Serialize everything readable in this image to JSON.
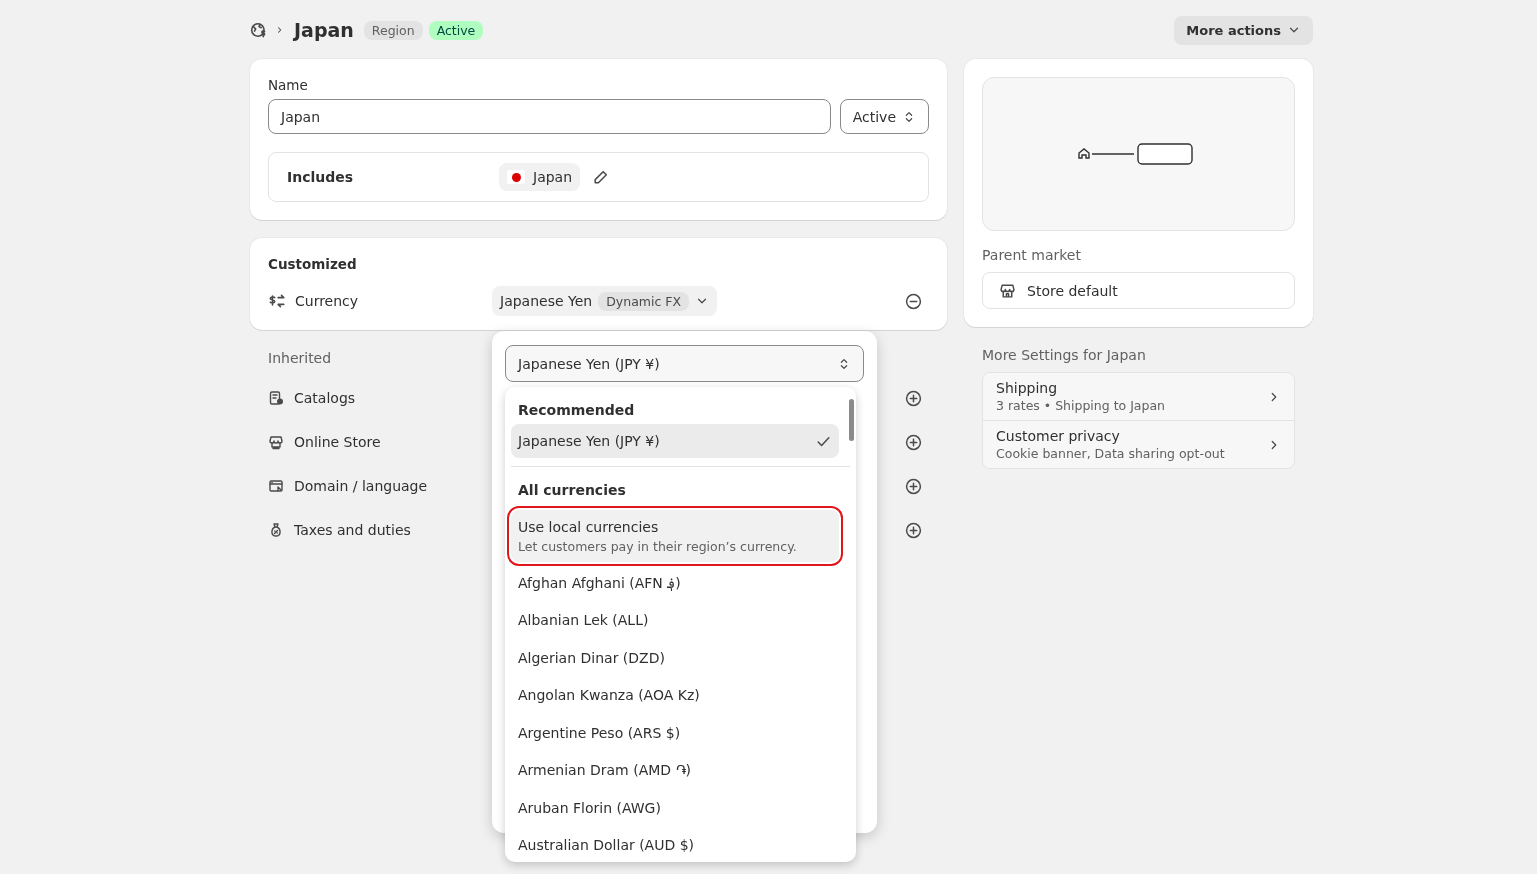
{
  "header": {
    "title": "Japan",
    "badges": [
      {
        "label": "Region",
        "kind": "neutral"
      },
      {
        "label": "Active",
        "kind": "success"
      }
    ],
    "more_actions": "More actions"
  },
  "name_card": {
    "label": "Name",
    "value": "Japan",
    "status": "Active",
    "includes_label": "Includes",
    "includes_chip": "Japan"
  },
  "customized": {
    "title": "Customized",
    "label": "Currency",
    "value": "Japanese Yen",
    "tag": "Dynamic FX"
  },
  "inherited": {
    "title": "Inherited",
    "items": [
      {
        "label": "Catalogs",
        "kind": "catalog"
      },
      {
        "label": "Online Store",
        "kind": "store"
      },
      {
        "label": "Domain / language",
        "kind": "domain"
      },
      {
        "label": "Taxes and duties",
        "kind": "taxes"
      }
    ]
  },
  "currency_popover": {
    "select_value": "Japanese Yen (JPY ¥)",
    "groups": [
      {
        "title": "Recommended",
        "options": [
          {
            "label": "Japanese Yen (JPY ¥)",
            "selected": true,
            "highlighted": false
          }
        ]
      },
      {
        "title": "All currencies",
        "options": [
          {
            "label": "Use local currencies",
            "description": "Let customers pay in their region’s currency.",
            "selected": false,
            "highlighted": true
          },
          {
            "label": "Afghan Afghani (AFN ؋)",
            "selected": false,
            "highlighted": false
          },
          {
            "label": "Albanian Lek (ALL)",
            "selected": false,
            "highlighted": false
          },
          {
            "label": "Algerian Dinar (DZD)",
            "selected": false,
            "highlighted": false
          },
          {
            "label": "Angolan Kwanza (AOA Kz)",
            "selected": false,
            "highlighted": false
          },
          {
            "label": "Argentine Peso (ARS $)",
            "selected": false,
            "highlighted": false
          },
          {
            "label": "Armenian Dram (AMD ֏)",
            "selected": false,
            "highlighted": false
          },
          {
            "label": "Aruban Florin (AWG)",
            "selected": false,
            "highlighted": false
          },
          {
            "label": "Australian Dollar (AUD $)",
            "selected": false,
            "highlighted": false
          }
        ]
      }
    ]
  },
  "parent_market": {
    "label": "Parent market",
    "value": "Store default"
  },
  "more_settings": {
    "title": "More Settings for Japan",
    "items": [
      {
        "title": "Shipping",
        "subtitle": "3 rates • Shipping to Japan"
      },
      {
        "title": "Customer privacy",
        "subtitle": "Cookie banner, Data sharing opt-out"
      }
    ]
  }
}
